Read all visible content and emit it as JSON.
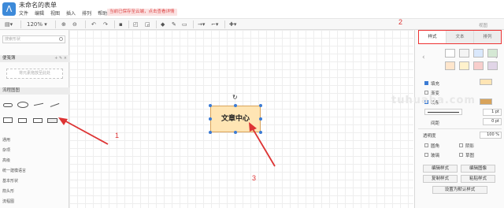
{
  "app": {
    "logo_glyph": "ᐱ",
    "title": "未命名的表单",
    "banner": "当前已保存至云端，点击查看详情"
  },
  "menu": [
    "文件",
    "编辑",
    "视图",
    "插入",
    "排列",
    "帮助"
  ],
  "toolbar": {
    "zoom": "120%"
  },
  "sidebar": {
    "search_placeholder": "搜索形状",
    "scratchpad_title": "便笺簿",
    "scratchpad_drop": "将元素拖放至此处",
    "flowchart_title": "流程图图",
    "libraries": [
      "通用",
      "杂项",
      "高级",
      "统一建模语言",
      "基本形状",
      "箭头形",
      "流程图"
    ]
  },
  "canvas": {
    "node_text": "文章中心",
    "rotate_glyph": "↻"
  },
  "right_panel": {
    "top_label": "视图",
    "tabs": [
      "样式",
      "文本",
      "排列"
    ],
    "fill_label": "填充",
    "gradient_label": "渐变",
    "line_label": "线条",
    "stroke_width": "1 pt",
    "spacing_label": "间距",
    "spacing_value": "0 pt",
    "opacity_label": "透明度",
    "opacity_value": "100 %",
    "options": [
      "圆角",
      "阴影",
      "玻璃",
      "草图"
    ],
    "buttons": [
      "编辑样式",
      "编辑图像",
      "复制样式",
      "粘贴样式"
    ],
    "default_button": "设置为默认样式"
  },
  "annotations": {
    "one": "1",
    "two": "2",
    "three": "3"
  },
  "watermark": "tuhuaba.com",
  "colors": {
    "accent": "#3b7bd4",
    "callout": "#dd3333",
    "node_fill": "#ffe5b4"
  }
}
